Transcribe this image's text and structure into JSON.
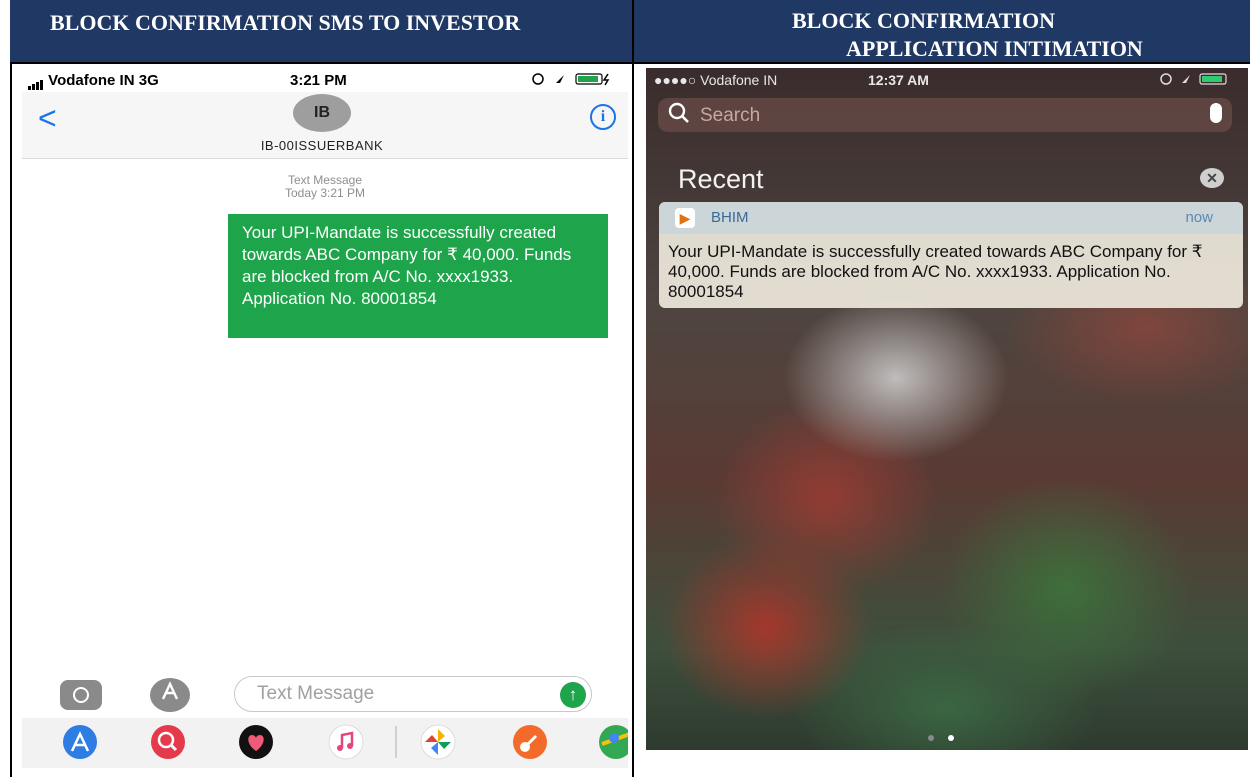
{
  "headers": {
    "left": "BLOCK CONFIRMATION SMS TO INVESTOR",
    "right_line1": "BLOCK CONFIRMATION",
    "right_line2": "APPLICATION  INTIMATION"
  },
  "sms_phone": {
    "status": {
      "carrier": "Vodafone IN  3G",
      "time": "3:21 PM"
    },
    "nav": {
      "back": "<",
      "avatar_initials": "IB",
      "contact": "IB-00ISSUERBANK",
      "info": "i"
    },
    "meta_line1": "Text Message",
    "meta_line2": "Today 3:21 PM",
    "message": "Your UPI-Mandate is successfully created towards ABC Company for ₹ 40,000. Funds are blocked from A/C No. xxxx1933. Application No. 80001854",
    "input_placeholder": "Text Message",
    "dock_colors": [
      "#2d7de3",
      "#e53a4c",
      "#111111",
      "#f2f2f2",
      "#f2f2f2",
      "#f36a2a",
      "#33a852"
    ]
  },
  "notification_phone": {
    "status": {
      "carrier": "●●●●○ Vodafone IN",
      "time": "12:37 AM"
    },
    "search_placeholder": "Search",
    "section_title": "Recent",
    "notification": {
      "app": "BHIM",
      "time": "now",
      "body": "Your UPI-Mandate is successfully created towards ABC Company for ₹ 40,000. Funds are blocked from A/C No. xxxx1933. Application No. 80001854"
    }
  }
}
